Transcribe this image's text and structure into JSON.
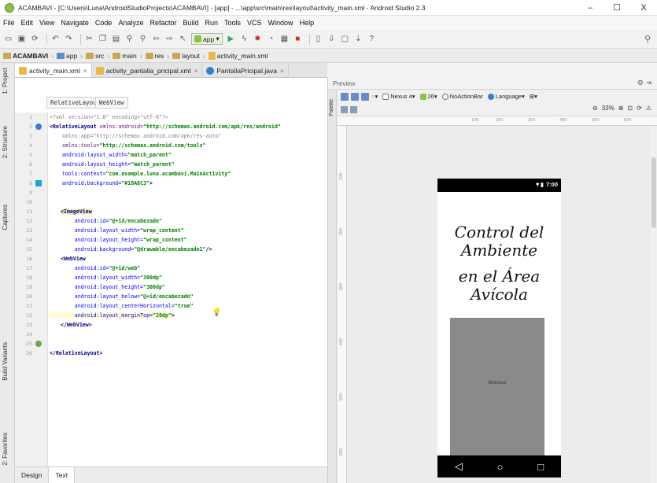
{
  "window": {
    "title": "ACAMBAVI - [C:\\Users\\Luna\\AndroidStudioProjects\\ACAMBAVI] - [app] - ...\\app\\src\\main\\res\\layout\\activity_main.xml - Android Studio 2.3",
    "minimize": "–",
    "maximize": "☐",
    "close": "X"
  },
  "menu": [
    "File",
    "Edit",
    "View",
    "Navigate",
    "Code",
    "Analyze",
    "Refactor",
    "Build",
    "Run",
    "Tools",
    "VCS",
    "Window",
    "Help"
  ],
  "toolbar": {
    "module": "app",
    "help": "?"
  },
  "breadcrumbs": [
    "ACAMBAVI",
    "app",
    "src",
    "main",
    "res",
    "layout",
    "activity_main.xml"
  ],
  "left_tool_windows": [
    "1: Project",
    "2: Structure",
    "Captures",
    "Build Variants",
    "2: Favorites"
  ],
  "editor_tabs": [
    {
      "label": "activity_main.xml",
      "active": true
    },
    {
      "label": "activity_pantalla_pricipal.xml",
      "active": false
    },
    {
      "label": "PantallaPricipal.java",
      "active": false
    }
  ],
  "component_path": [
    "RelativeLayout",
    "WebView"
  ],
  "line_numbers": [
    "1",
    "2",
    "3",
    "4",
    "5",
    "6",
    "7",
    "8",
    "9",
    "10",
    "11",
    "12",
    "13",
    "14",
    "15",
    "16",
    "17",
    "18",
    "19",
    "20",
    "21",
    "22",
    "23",
    "24",
    "25",
    "26"
  ],
  "code": {
    "l1": "<?xml version=\"1.0\" encoding=\"utf-8\"?>",
    "l2a": "<RelativeLayout",
    "l2b": " xmlns:android=",
    "l2c": "\"http://schemas.android.com/apk/res/android\"",
    "l3a": "    xmlns:app=",
    "l3b": "\"http://schemas.android.com/apk/res-auto\"",
    "l4a": "    xmlns:tools=",
    "l4b": "\"http://schemas.android.com/tools\"",
    "l5a": "    android:layout_width=",
    "l5b": "\"match_parent\"",
    "l6a": "    android:layout_height=",
    "l6b": "\"match_parent\"",
    "l7a": "    tools:context=",
    "l7b": "\"com.example.luna.acambavi.MainActivity\"",
    "l8a": "    android:background=",
    "l8b": "\"#18A8C3\"",
    "l8c": ">",
    "l10": "<ImageView",
    "l11a": "        android:id=",
    "l11b": "\"@+id/encabezado\"",
    "l12a": "        android:layout_width=",
    "l12b": "\"wrap_content\"",
    "l13a": "        android:layout_height=",
    "l13b": "\"wrap_content\"",
    "l14a": "        android:background=",
    "l14b": "\"@drawable/encabezado1\"",
    "l14c": "/>",
    "l15": "<WebView",
    "l16a": "        android:id=",
    "l16b": "\"@+id/web\"",
    "l17a": "        android:layout_width=",
    "l17b": "\"300dp\"",
    "l18a": "        android:layout_height=",
    "l18b": "\"300dp\"",
    "l19a": "        android:layout_below=",
    "l19b": "\"@+id/encabezado\"",
    "l20a": "        android:layout_centerHorizontal=",
    "l20b": "\"true\"",
    "l21a": "        android:layout_marginTop=",
    "l21b": "\"20dp\"",
    "l21c": ">",
    "l22": "</WebView>",
    "l25": "</RelativeLayout>"
  },
  "bottom_tabs": [
    "Design",
    "Text"
  ],
  "preview": {
    "label": "Preview",
    "palette": "Palette",
    "device": "Nexus 4",
    "api": "26",
    "theme": "NoActionBar",
    "language": "Language",
    "zoom": "33%",
    "ruler_x": [
      "100",
      "200",
      "300",
      "400",
      "500",
      "600"
    ],
    "ruler_y": [
      "100",
      "200",
      "300",
      "400",
      "500",
      "600"
    ],
    "status_time": "7:00",
    "heading_line1": "Control del Ambiente",
    "heading_line2": "en el Área Avícola",
    "webview_label": "WebView",
    "background_color": "#18A8C3"
  }
}
